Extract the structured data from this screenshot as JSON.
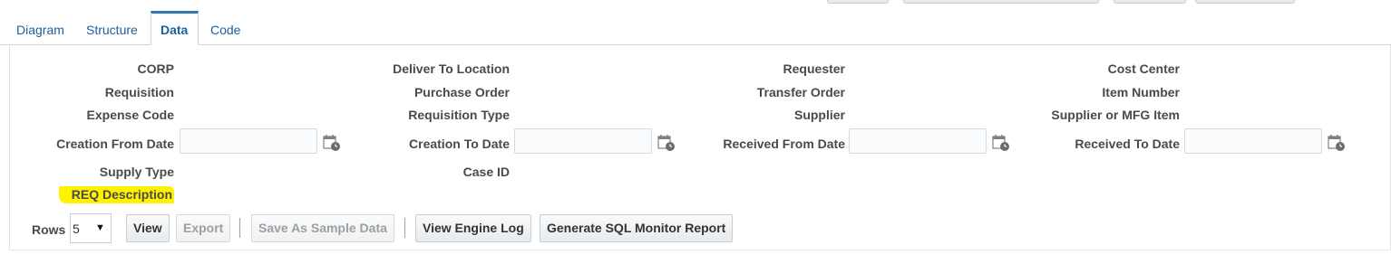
{
  "tabs": [
    {
      "label": "Diagram"
    },
    {
      "label": "Structure"
    },
    {
      "label": "Data"
    },
    {
      "label": "Code"
    }
  ],
  "active_tab": "Data",
  "fields": {
    "corp": "CORP",
    "requisition": "Requisition",
    "expense_code": "Expense Code",
    "creation_from_date": "Creation From Date",
    "supply_type": "Supply Type",
    "req_description": "REQ Description",
    "deliver_to_location": "Deliver To Location",
    "purchase_order": "Purchase Order",
    "requisition_type": "Requisition Type",
    "creation_to_date": "Creation To Date",
    "case_id": "Case ID",
    "requester": "Requester",
    "transfer_order": "Transfer Order",
    "supplier": "Supplier",
    "received_from_date": "Received From Date",
    "cost_center": "Cost Center",
    "item_number": "Item Number",
    "supplier_or_mfg_item": "Supplier or MFG Item",
    "received_to_date": "Received To Date"
  },
  "inputs": {
    "creation_from_date": "",
    "creation_to_date": "",
    "received_from_date": "",
    "received_to_date": ""
  },
  "toolbar": {
    "rows_label": "Rows",
    "rows_value": "5",
    "view": "View",
    "export": "Export",
    "save_sample": "Save As Sample Data",
    "view_engine_log": "View Engine Log",
    "sql_monitor": "Generate SQL Monitor Report"
  },
  "colors": {
    "highlight": "#fff200",
    "tab_accent": "#2e79b9",
    "link": "#1a5f9e"
  },
  "icons": [
    "calendar-icon",
    "dropdown-arrow-icon"
  ]
}
